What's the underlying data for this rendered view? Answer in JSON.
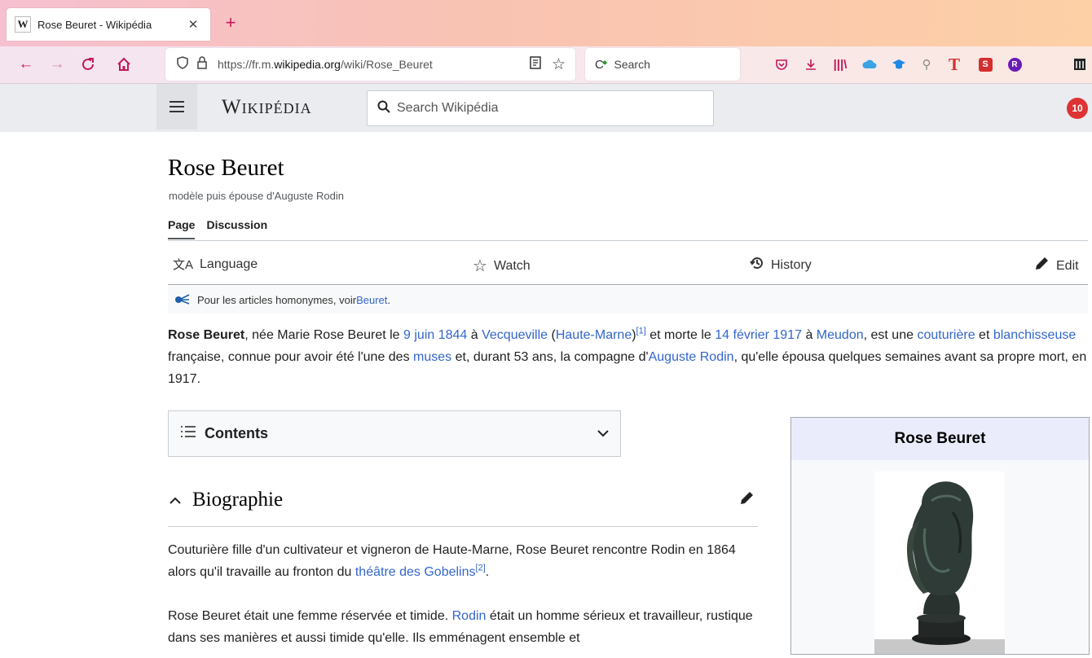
{
  "browser": {
    "tab": {
      "favicon": "W",
      "title": "Rose Beuret - Wikipédia",
      "close": "✕"
    },
    "new_tab": "+",
    "url_prefix": "https://fr.m.",
    "url_domain": "wikipedia.org",
    "url_path": "/wiki/Rose_Beuret",
    "search_placeholder": "Search"
  },
  "wiki": {
    "logo": "Wikipédia",
    "search_placeholder": "Search Wikipédia",
    "notifications": "10"
  },
  "article": {
    "title": "Rose Beuret",
    "subtitle": "modèle puis épouse d'Auguste Rodin",
    "tabs": [
      "Page",
      "Discussion"
    ],
    "actions": {
      "language": "Language",
      "watch": "Watch",
      "history": "History",
      "edit": "Edit"
    },
    "hatnote": {
      "text": "Pour les articles homonymes, voir ",
      "link": "Beuret",
      "end": "."
    },
    "lede": {
      "name": "Rose Beuret",
      "t1": ", née Marie Rose Beuret le ",
      "l1": "9 juin 1844",
      "t2": " à ",
      "l2": "Vecqueville",
      "t3": " (",
      "l3": "Haute-Marne",
      "t4": ")",
      "ref1": "[1]",
      "t5": " et morte le ",
      "l4": "14 février 1917",
      "t6": " à ",
      "l5": "Meudon",
      "t7": ", est une ",
      "l6": "couturière",
      "t8": " et ",
      "l7": "blanchisseuse",
      "t9": " française, connue pour avoir été l'une des ",
      "l8": "muses",
      "t10": " et, durant 53 ans, la compagne d'",
      "l9": "Auguste Rodin",
      "t11": ", qu'elle épousa quelques semaines avant sa propre mort, en 1917."
    },
    "contents_label": "Contents",
    "section_title": "Biographie",
    "p1": {
      "t1": "Couturière fille d'un cultivateur et vigneron de Haute-Marne, Rose Beuret rencontre Rodin en 1864 alors qu'il travaille au fronton du ",
      "l1": "théâtre des Gobelins",
      "ref": "[2]",
      "t2": "."
    },
    "p2": {
      "t1": "Rose Beuret était une femme réservée et timide. ",
      "l1": "Rodin",
      "t2": " était un homme sérieux et travailleur, rustique dans ses manières et aussi timide qu'elle. Ils emménagent ensemble et"
    },
    "infobox_title": "Rose Beuret"
  },
  "colors": {
    "link": "#3366cc",
    "accent": "#c2185b",
    "badge": "#d33333"
  },
  "icons": [
    "back-icon",
    "forward-icon",
    "reload-icon",
    "home-icon",
    "shield-icon",
    "lock-icon",
    "reader-icon",
    "bookmark-star-icon",
    "pocket-icon",
    "download-icon",
    "library-icon",
    "cloud-icon",
    "graduation-icon",
    "pin-icon",
    "t-icon",
    "s-icon",
    "r-icon",
    "building-icon"
  ]
}
